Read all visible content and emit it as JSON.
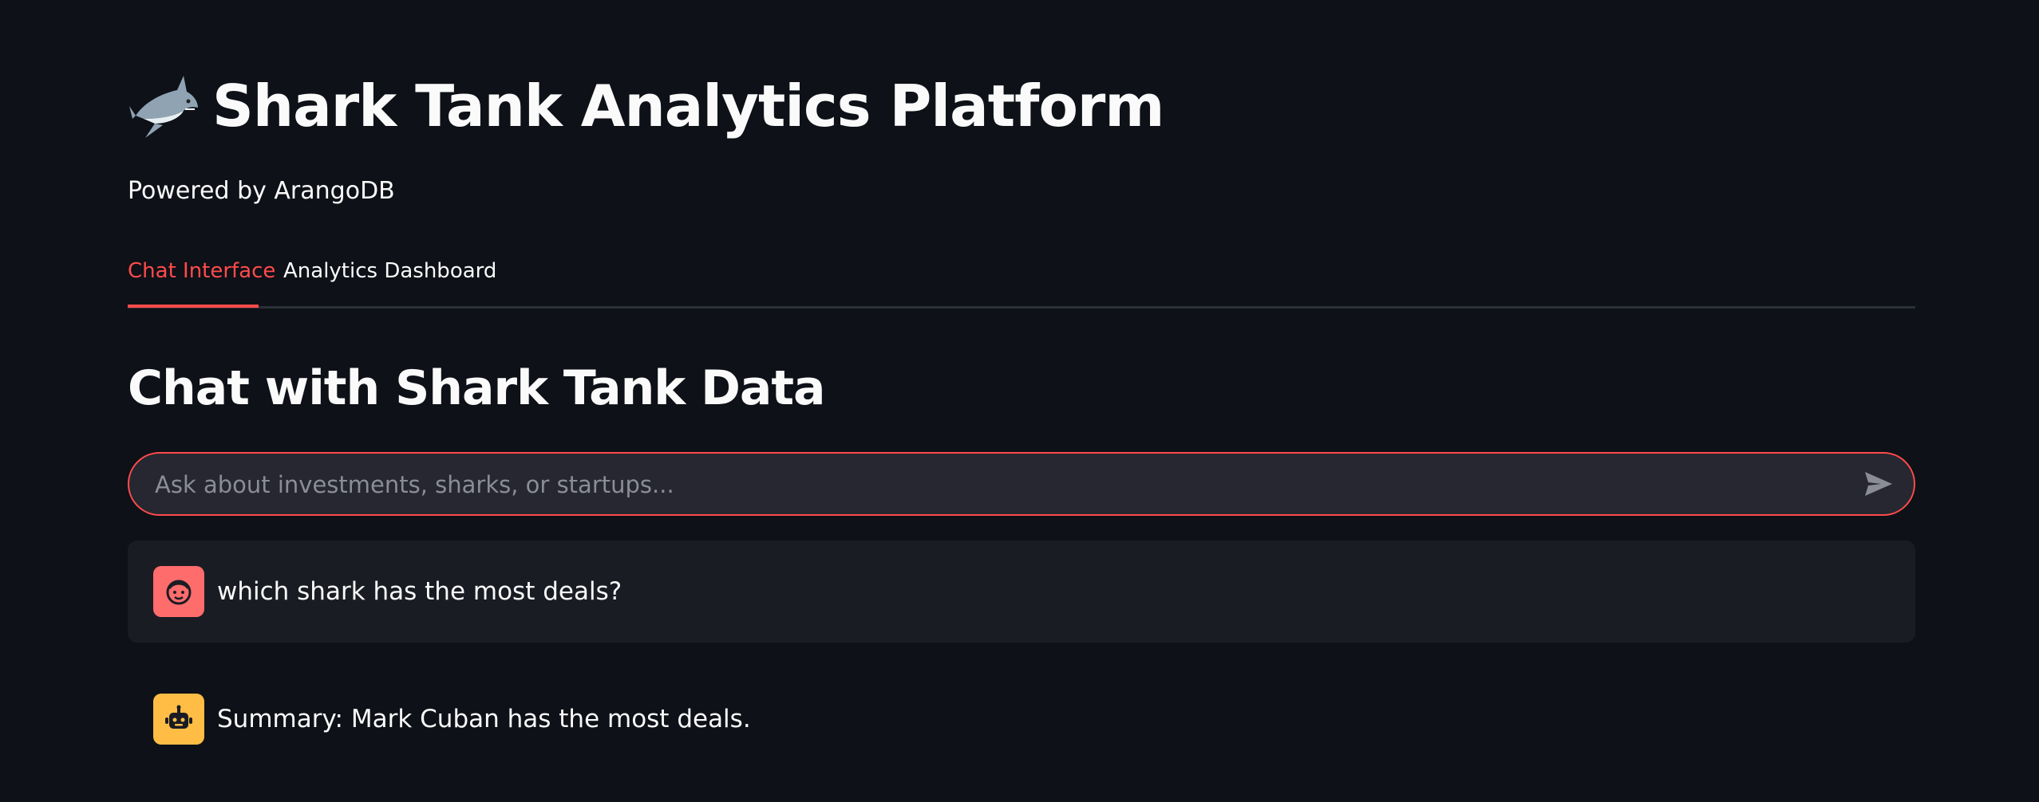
{
  "header": {
    "title": "Shark Tank Analytics Platform",
    "title_icon": "shark-emoji",
    "subtitle": "Powered by ArangoDB"
  },
  "tabs": [
    {
      "label": "Chat Interface",
      "active": true
    },
    {
      "label": "Analytics Dashboard",
      "active": false
    }
  ],
  "chat": {
    "section_title": "Chat with Shark Tank Data",
    "input_placeholder": "Ask about investments, sharks, or startups...",
    "input_value": "",
    "send_icon": "send-icon",
    "messages": [
      {
        "role": "user",
        "avatar_icon": "user-face-icon",
        "text": "which shark has the most deals?"
      },
      {
        "role": "assistant",
        "avatar_icon": "robot-icon",
        "text": "Summary: Mark Cuban has the most deals."
      }
    ]
  },
  "colors": {
    "background": "#0e1117",
    "accent": "#ff4b4b",
    "user_avatar": "#ff6c6c",
    "assistant_avatar": "#ffbd45",
    "input_bg": "#262730",
    "message_bg": "#1a1c24"
  }
}
